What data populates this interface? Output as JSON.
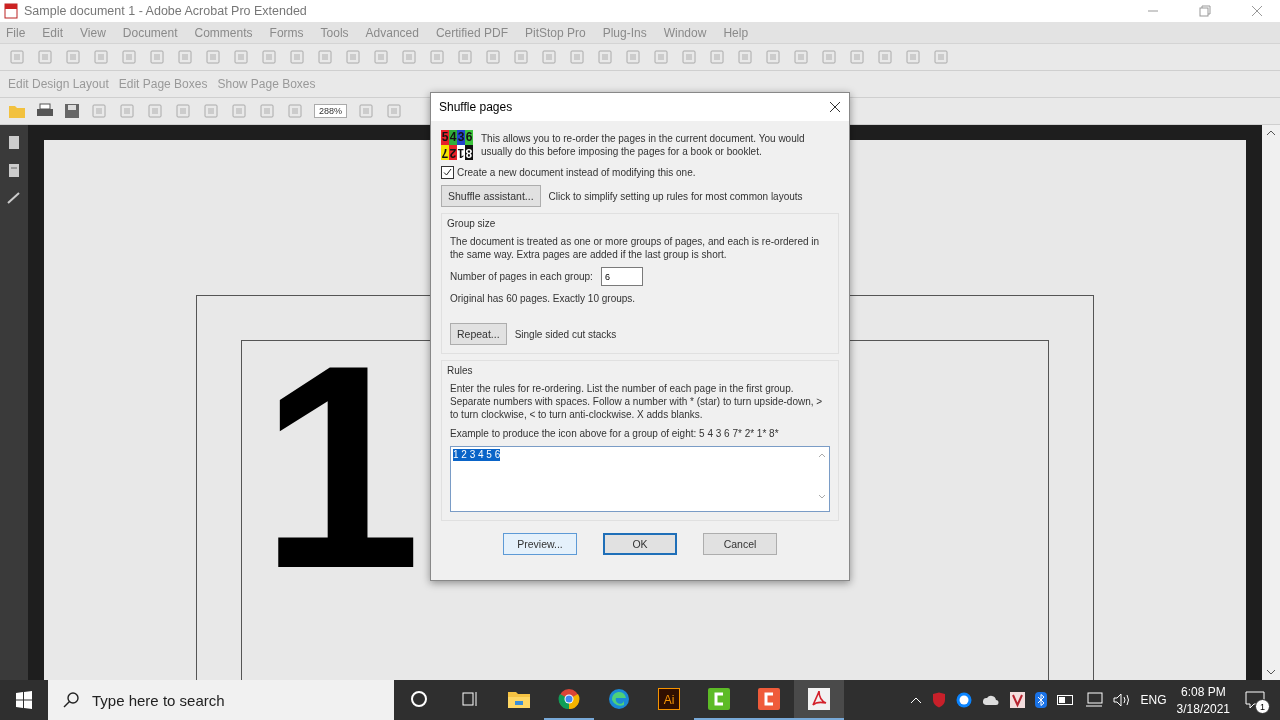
{
  "window": {
    "title": "Sample document 1 - Adobe Acrobat Pro Extended"
  },
  "menu": [
    "File",
    "Edit",
    "View",
    "Document",
    "Comments",
    "Forms",
    "Tools",
    "Advanced",
    "Certified PDF",
    "PitStop Pro",
    "Plug-Ins",
    "Window",
    "Help"
  ],
  "design_toolbar": [
    "Edit Design Layout",
    "Edit Page Boxes",
    "Show Page Boxes"
  ],
  "zoom": {
    "value": "288%"
  },
  "document": {
    "page_text": "1"
  },
  "dialog": {
    "title": "Shuffle pages",
    "icon_digits": [
      {
        "digit": "5",
        "color": "#e8202a",
        "rotated": false
      },
      {
        "digit": "4",
        "color": "#2fae3a",
        "rotated": false
      },
      {
        "digit": "3",
        "color": "#2244cc",
        "rotated": false
      },
      {
        "digit": "6",
        "color": "#3cc43c",
        "rotated": false
      },
      {
        "digit": "7",
        "color": "#f5e400",
        "rotated": true
      },
      {
        "digit": "2",
        "color": "#e8202a",
        "rotated": true
      },
      {
        "digit": "1",
        "color": "#ffffff",
        "rotated": true
      },
      {
        "digit": "8",
        "color": "#111111",
        "rotated": true
      }
    ],
    "intro": "This allows you to re-order the pages in the current document. You would usually do this before imposing the pages for a book or booklet.",
    "new_document": {
      "label": "Create a new document instead of modifying this one.",
      "checked": true
    },
    "assistant": {
      "button": "Shuffle assistant...",
      "hint": "Click to simplify setting up rules for most common layouts"
    },
    "group_size": {
      "title": "Group size",
      "description": "The document is treated as one or more groups of pages, and each is re-ordered in the same way. Extra pages are added if the last group is short.",
      "field_label": "Number of pages in each group:",
      "value": "6",
      "summary": "Original has 60 pages. Exactly 10 groups.",
      "repeat_button": "Repeat...",
      "repeat_hint": "Single sided cut stacks"
    },
    "rules": {
      "title": "Rules",
      "description": "Enter the rules for re-ordering. List the number of each page in the first group. Separate numbers with spaces. Follow a number with * (star)  to turn upside-down, > to turn clockwise, < to turn anti-clockwise. X adds blanks.",
      "example": "Example to produce the icon above for a group of eight: 5 4 3 6 7* 2* 1* 8*",
      "value": "1 2 3 4 5 6",
      "text_selected": true
    },
    "buttons": [
      {
        "label": "Preview...",
        "kind": "hover"
      },
      {
        "label": "OK",
        "kind": "default"
      },
      {
        "label": "Cancel",
        "kind": "normal"
      }
    ]
  },
  "taskbar": {
    "search_placeholder": "Type here to search",
    "apps": [
      {
        "kind": "explorer",
        "running": false,
        "selected": false
      },
      {
        "kind": "chrome",
        "running": true,
        "selected": false
      },
      {
        "kind": "edge",
        "running": false,
        "selected": false
      },
      {
        "kind": "illustrator",
        "label": "Ai",
        "running": false,
        "selected": false
      },
      {
        "kind": "camtasia-green",
        "running": true,
        "selected": false
      },
      {
        "kind": "camtasia-red",
        "running": true,
        "selected": false
      },
      {
        "kind": "acrobat",
        "running": true,
        "selected": true
      }
    ],
    "language": "ENG",
    "time": "6:08 PM",
    "date": "3/18/2021",
    "notifications": "1"
  }
}
